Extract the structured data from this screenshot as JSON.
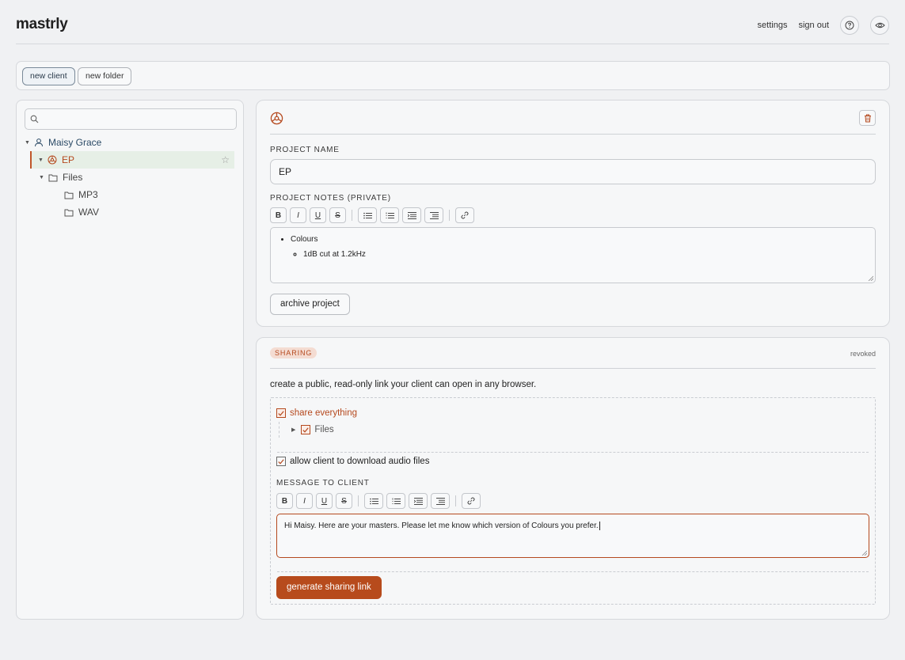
{
  "header": {
    "logo": "mastrly",
    "settings_label": "settings",
    "signout_label": "sign out"
  },
  "toolbar": {
    "new_client_label": "new client",
    "new_folder_label": "new folder"
  },
  "sidebar": {
    "search_placeholder": "",
    "tree": {
      "client": "Maisy Grace",
      "project": "EP",
      "folder": "Files",
      "subfolders": [
        "MP3",
        "WAV"
      ]
    }
  },
  "project": {
    "name_label": "PROJECT NAME",
    "name_value": "EP",
    "notes_label": "PROJECT NOTES (PRIVATE)",
    "notes": {
      "item": "Colours",
      "subitem": "1dB cut at 1.2kHz"
    },
    "archive_label": "archive project"
  },
  "sharing": {
    "badge": "SHARING",
    "status": "revoked",
    "description": "create a public, read-only link your client can open in any browser.",
    "share_everything_label": "share everything",
    "files_label": "Files",
    "download_label": "allow client to download audio files",
    "message_label": "MESSAGE TO CLIENT",
    "message_value": "Hi Maisy. Here are your masters. Please let me know which version of Colours you prefer.",
    "generate_label": "generate sharing link"
  },
  "editor_toolbar": {
    "bold": "B",
    "italic": "I",
    "underline": "U",
    "strike": "S"
  },
  "colors": {
    "accent": "#b74b1c",
    "client_blue": "#2b4a66",
    "background": "#f0f1f3"
  }
}
